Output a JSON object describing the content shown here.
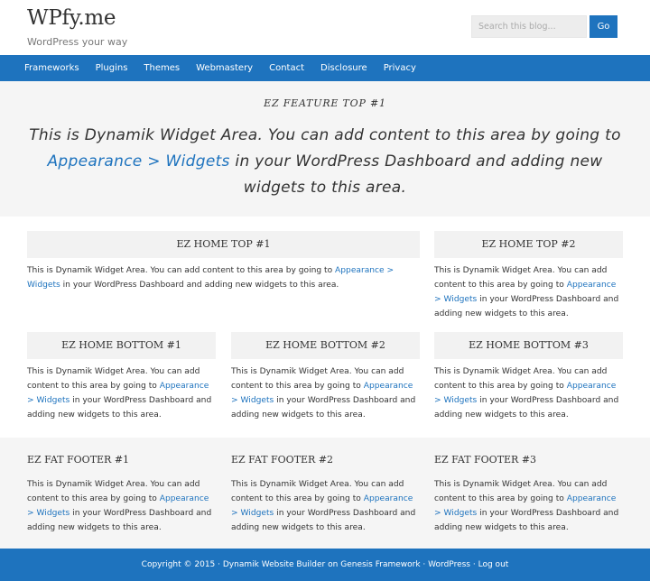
{
  "header": {
    "site_title": "WPfy.me",
    "site_description": "WordPress your way",
    "search_placeholder": "Search this blog...",
    "search_button": "Go"
  },
  "nav": {
    "items": [
      "Frameworks",
      "Plugins",
      "Themes",
      "Webmastery",
      "Contact",
      "Disclosure",
      "Privacy"
    ]
  },
  "feature": {
    "title": "EZ FEATURE TOP #1",
    "text_before": "This is Dynamik Widget Area. You can add content to this area by going to ",
    "link": "Appearance > Widgets",
    "text_after": " in your WordPress Dashboard and adding new widgets to this area."
  },
  "widget_common": {
    "text_before": "This is Dynamik Widget Area. You can add content to this area by going to ",
    "link": "Appearance > Widgets",
    "text_after": " in your WordPress Dashboard and adding new widgets to this area."
  },
  "home_top": [
    {
      "title": "EZ HOME TOP #1"
    },
    {
      "title": "EZ HOME TOP #2"
    }
  ],
  "home_bottom": [
    {
      "title": "EZ HOME BOTTOM #1"
    },
    {
      "title": "EZ HOME BOTTOM #2"
    },
    {
      "title": "EZ HOME BOTTOM #3"
    }
  ],
  "fat_footer": [
    {
      "title": "EZ FAT FOOTER #1"
    },
    {
      "title": "EZ FAT FOOTER #2"
    },
    {
      "title": "EZ FAT FOOTER #3"
    }
  ],
  "footer": {
    "copyright": "Copyright © 2015 ·",
    "builder_link": "Dynamik Website Builder",
    "on": "on",
    "framework_link": "Genesis Framework",
    "sep1": "·",
    "wordpress_link": "WordPress",
    "sep2": "·",
    "logout_link": "Log out"
  },
  "colors": {
    "accent": "#1e73be",
    "panel": "#f5f5f5",
    "title_box": "#f2f2f2"
  }
}
